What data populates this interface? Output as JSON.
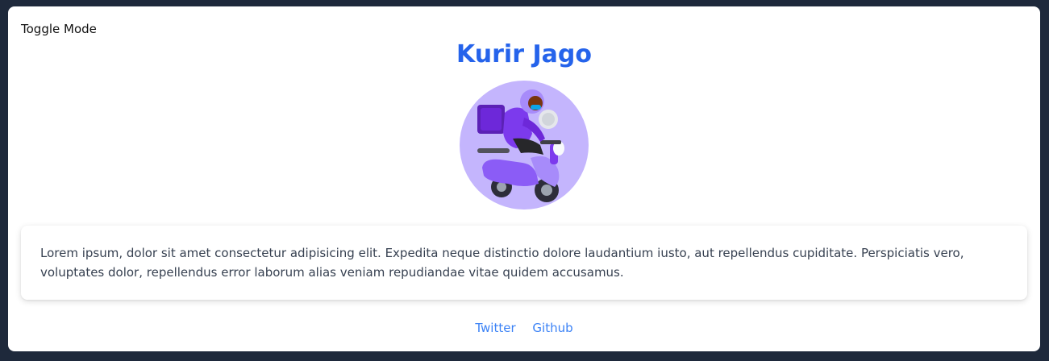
{
  "header": {
    "toggle_label": "Toggle Mode",
    "title": "Kurir Jago"
  },
  "avatar": {
    "icon": "scooter-courier-illustration",
    "background_color": "#c4b5fd"
  },
  "description": {
    "text": "Lorem ipsum, dolor sit amet consectetur adipisicing elit. Expedita neque distinctio dolore laudantium iusto, aut repellendus cupiditate. Perspiciatis vero, voluptates dolor, repellendus error laborum alias veniam repudiandae vitae quidem accusamus."
  },
  "footer": {
    "links": [
      {
        "label": "Twitter"
      },
      {
        "label": "Github"
      }
    ]
  },
  "colors": {
    "page_background": "#1e293b",
    "card_background": "#ffffff",
    "title": "#2563eb",
    "link": "#3b82f6"
  }
}
